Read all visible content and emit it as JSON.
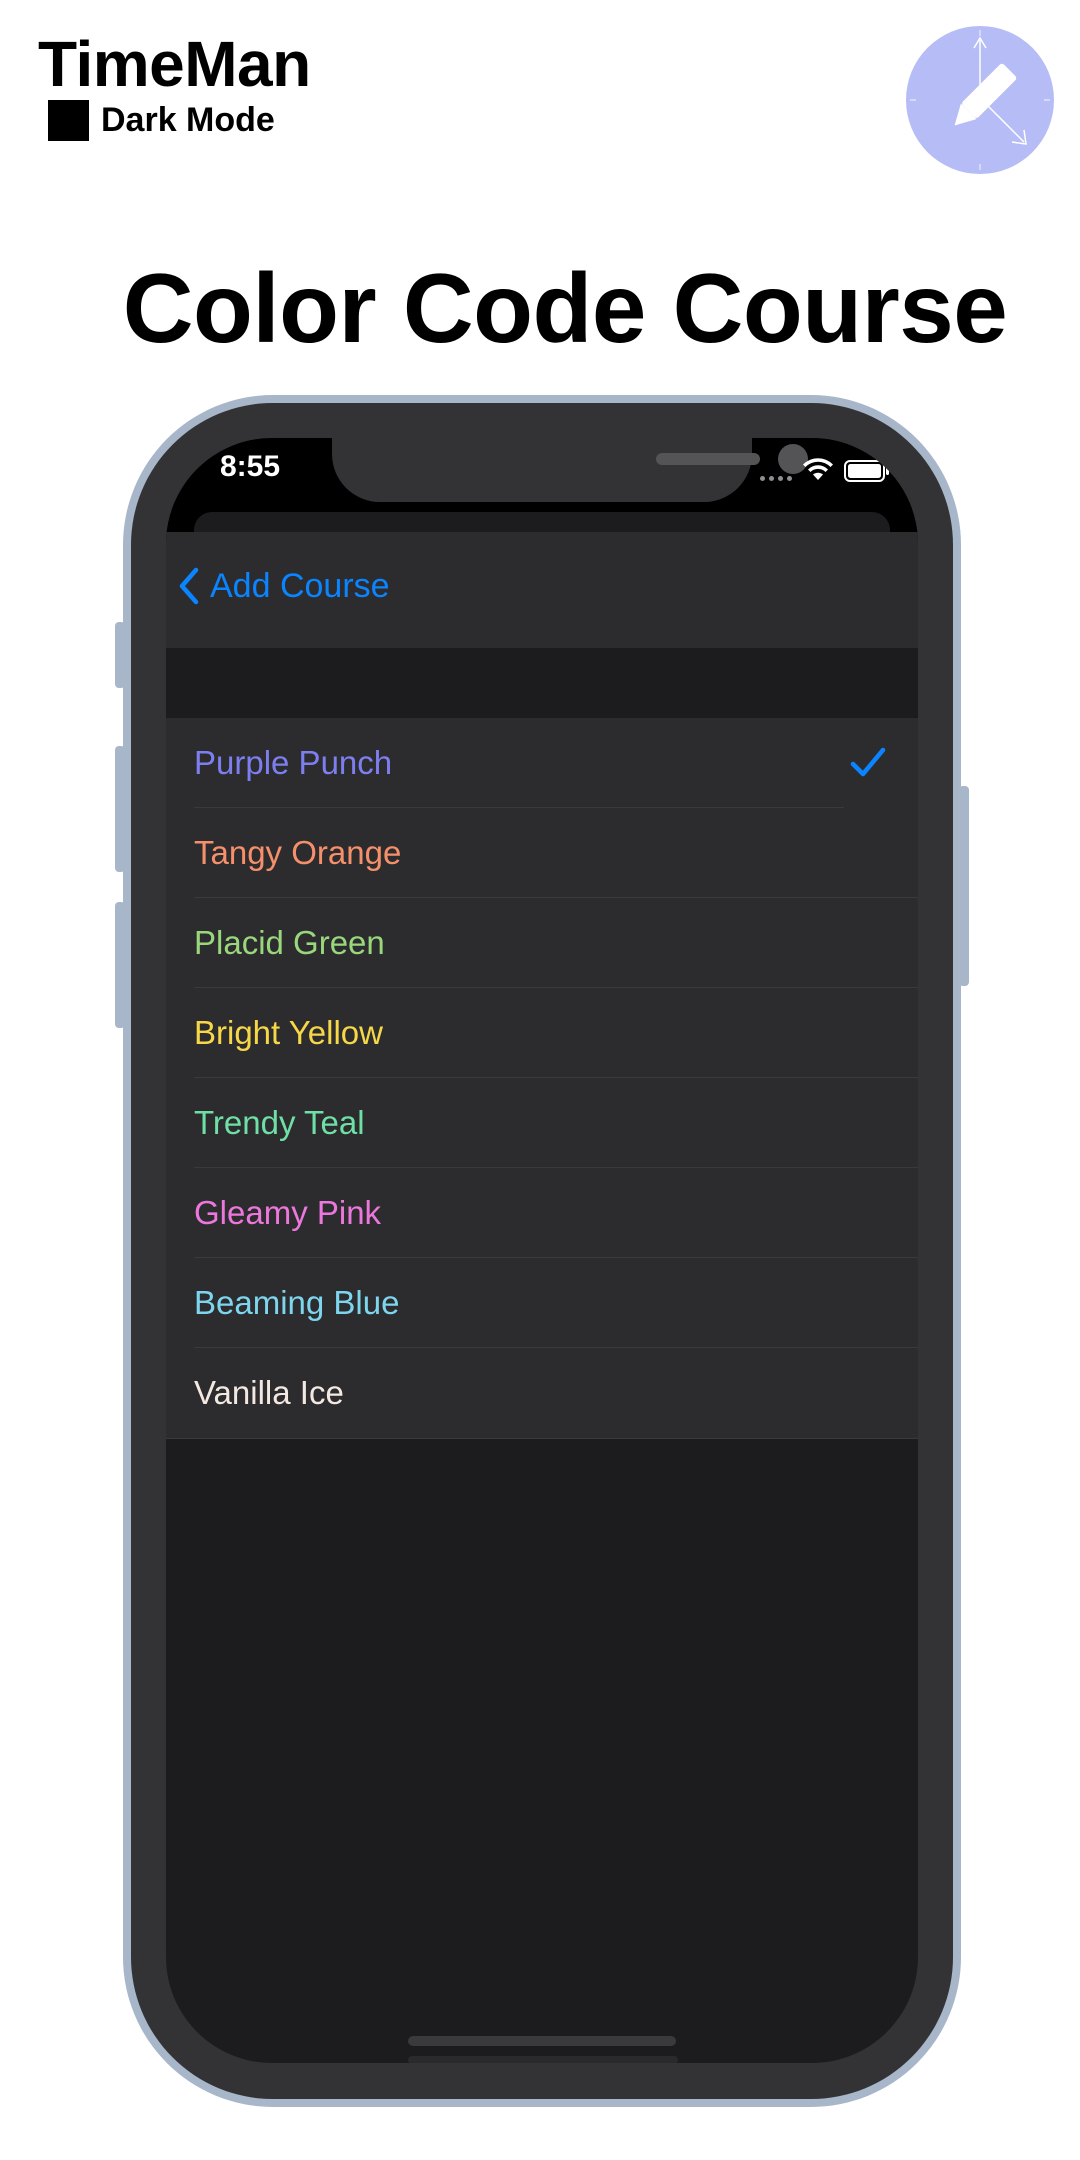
{
  "header": {
    "app_name": "TimeMan",
    "mode_label": "Dark Mode",
    "logo_icon": "clock-pencil-icon"
  },
  "page_title": "Color Code Course",
  "device": {
    "status_bar": {
      "time": "8:55",
      "icons": [
        "signal-icon",
        "wifi-icon",
        "battery-icon"
      ]
    },
    "nav": {
      "back_label": "Add Course",
      "back_icon": "chevron-left-icon"
    },
    "colors": [
      {
        "label": "Purple Punch",
        "color": "#7d7ff0",
        "selected": true
      },
      {
        "label": "Tangy Orange",
        "color": "#f5906a",
        "selected": false
      },
      {
        "label": "Placid Green",
        "color": "#99d67c",
        "selected": false
      },
      {
        "label": "Bright Yellow",
        "color": "#f6d747",
        "selected": false
      },
      {
        "label": "Trendy Teal",
        "color": "#6ee0a6",
        "selected": false
      },
      {
        "label": "Gleamy Pink",
        "color": "#ec77dd",
        "selected": false
      },
      {
        "label": "Beaming Blue",
        "color": "#7dd5ee",
        "selected": false
      },
      {
        "label": "Vanilla Ice",
        "color": "#f3e8e2",
        "selected": false
      }
    ]
  },
  "palette": {
    "accent": "#0a84ff",
    "logo_bg": "#b6bcf6",
    "frame": "#a8b6c9"
  }
}
